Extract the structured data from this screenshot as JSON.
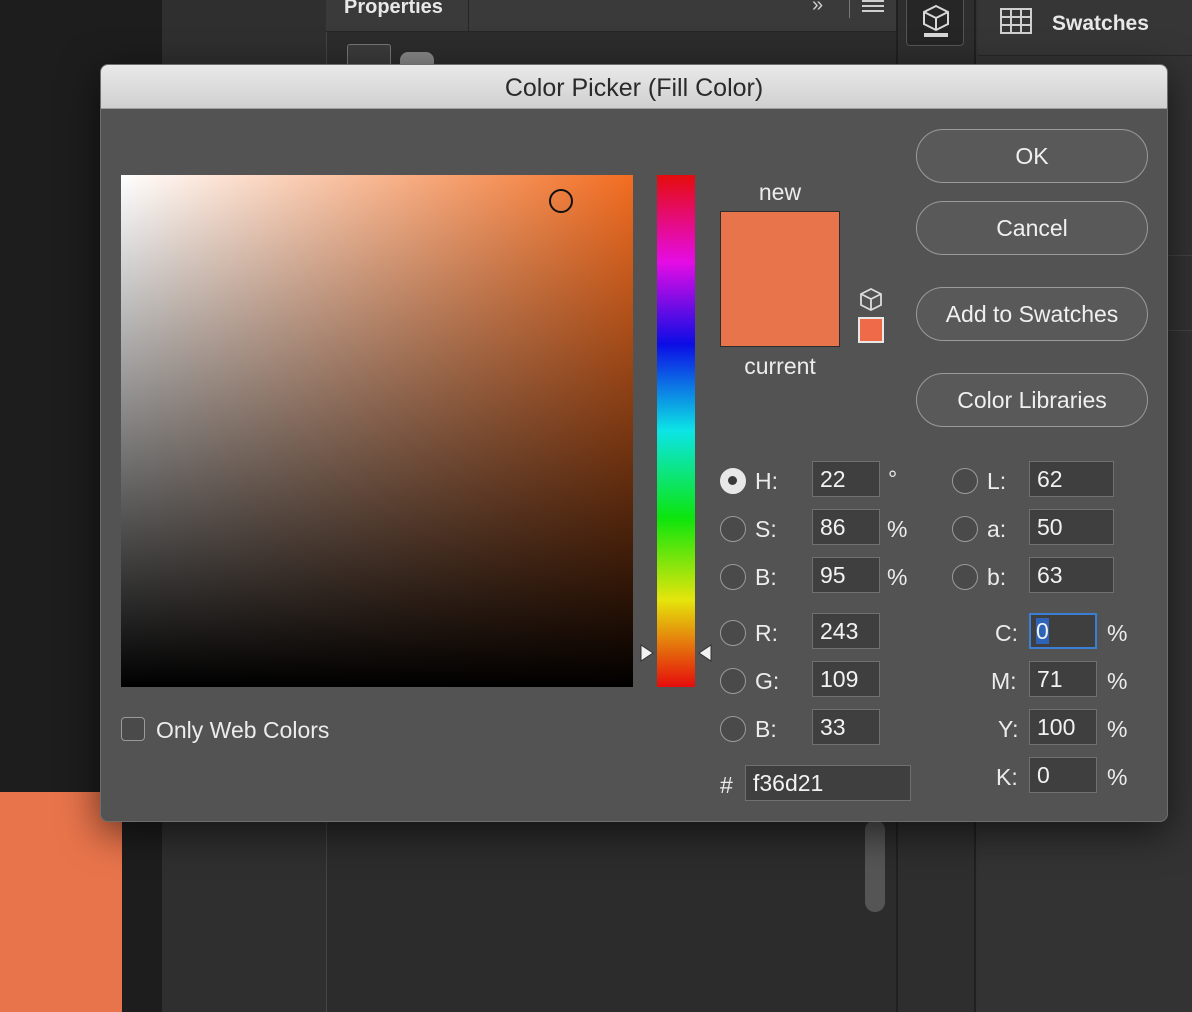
{
  "background": {
    "properties_panel": {
      "title": "Properties"
    },
    "swatches_panel": {
      "title": "Swatches"
    }
  },
  "dialog": {
    "title": "Color Picker (Fill Color)",
    "preview": {
      "new_label": "new",
      "current_label": "current",
      "new_color": "#e8744b",
      "current_color": "#e8744b"
    },
    "buttons": {
      "ok": "OK",
      "cancel": "Cancel",
      "add_to_swatches": "Add to Swatches",
      "color_libraries": "Color Libraries"
    },
    "hsb": {
      "h": {
        "label": "H:",
        "value": "22",
        "unit": "°",
        "selected": true
      },
      "s": {
        "label": "S:",
        "value": "86",
        "unit": "%"
      },
      "b": {
        "label": "B:",
        "value": "95",
        "unit": "%"
      }
    },
    "rgb": {
      "r": {
        "label": "R:",
        "value": "243"
      },
      "g": {
        "label": "G:",
        "value": "109"
      },
      "b": {
        "label": "B:",
        "value": "33"
      }
    },
    "lab": {
      "l": {
        "label": "L:",
        "value": "62"
      },
      "a": {
        "label": "a:",
        "value": "50"
      },
      "b": {
        "label": "b:",
        "value": "63"
      }
    },
    "cmyk": {
      "c": {
        "label": "C:",
        "value": "0",
        "unit": "%"
      },
      "m": {
        "label": "M:",
        "value": "71",
        "unit": "%"
      },
      "y": {
        "label": "Y:",
        "value": "100",
        "unit": "%"
      },
      "k": {
        "label": "K:",
        "value": "0",
        "unit": "%"
      }
    },
    "hex": {
      "label": "#",
      "value": "f36d21"
    },
    "only_web_colors": {
      "label": "Only Web Colors",
      "checked": false
    }
  }
}
